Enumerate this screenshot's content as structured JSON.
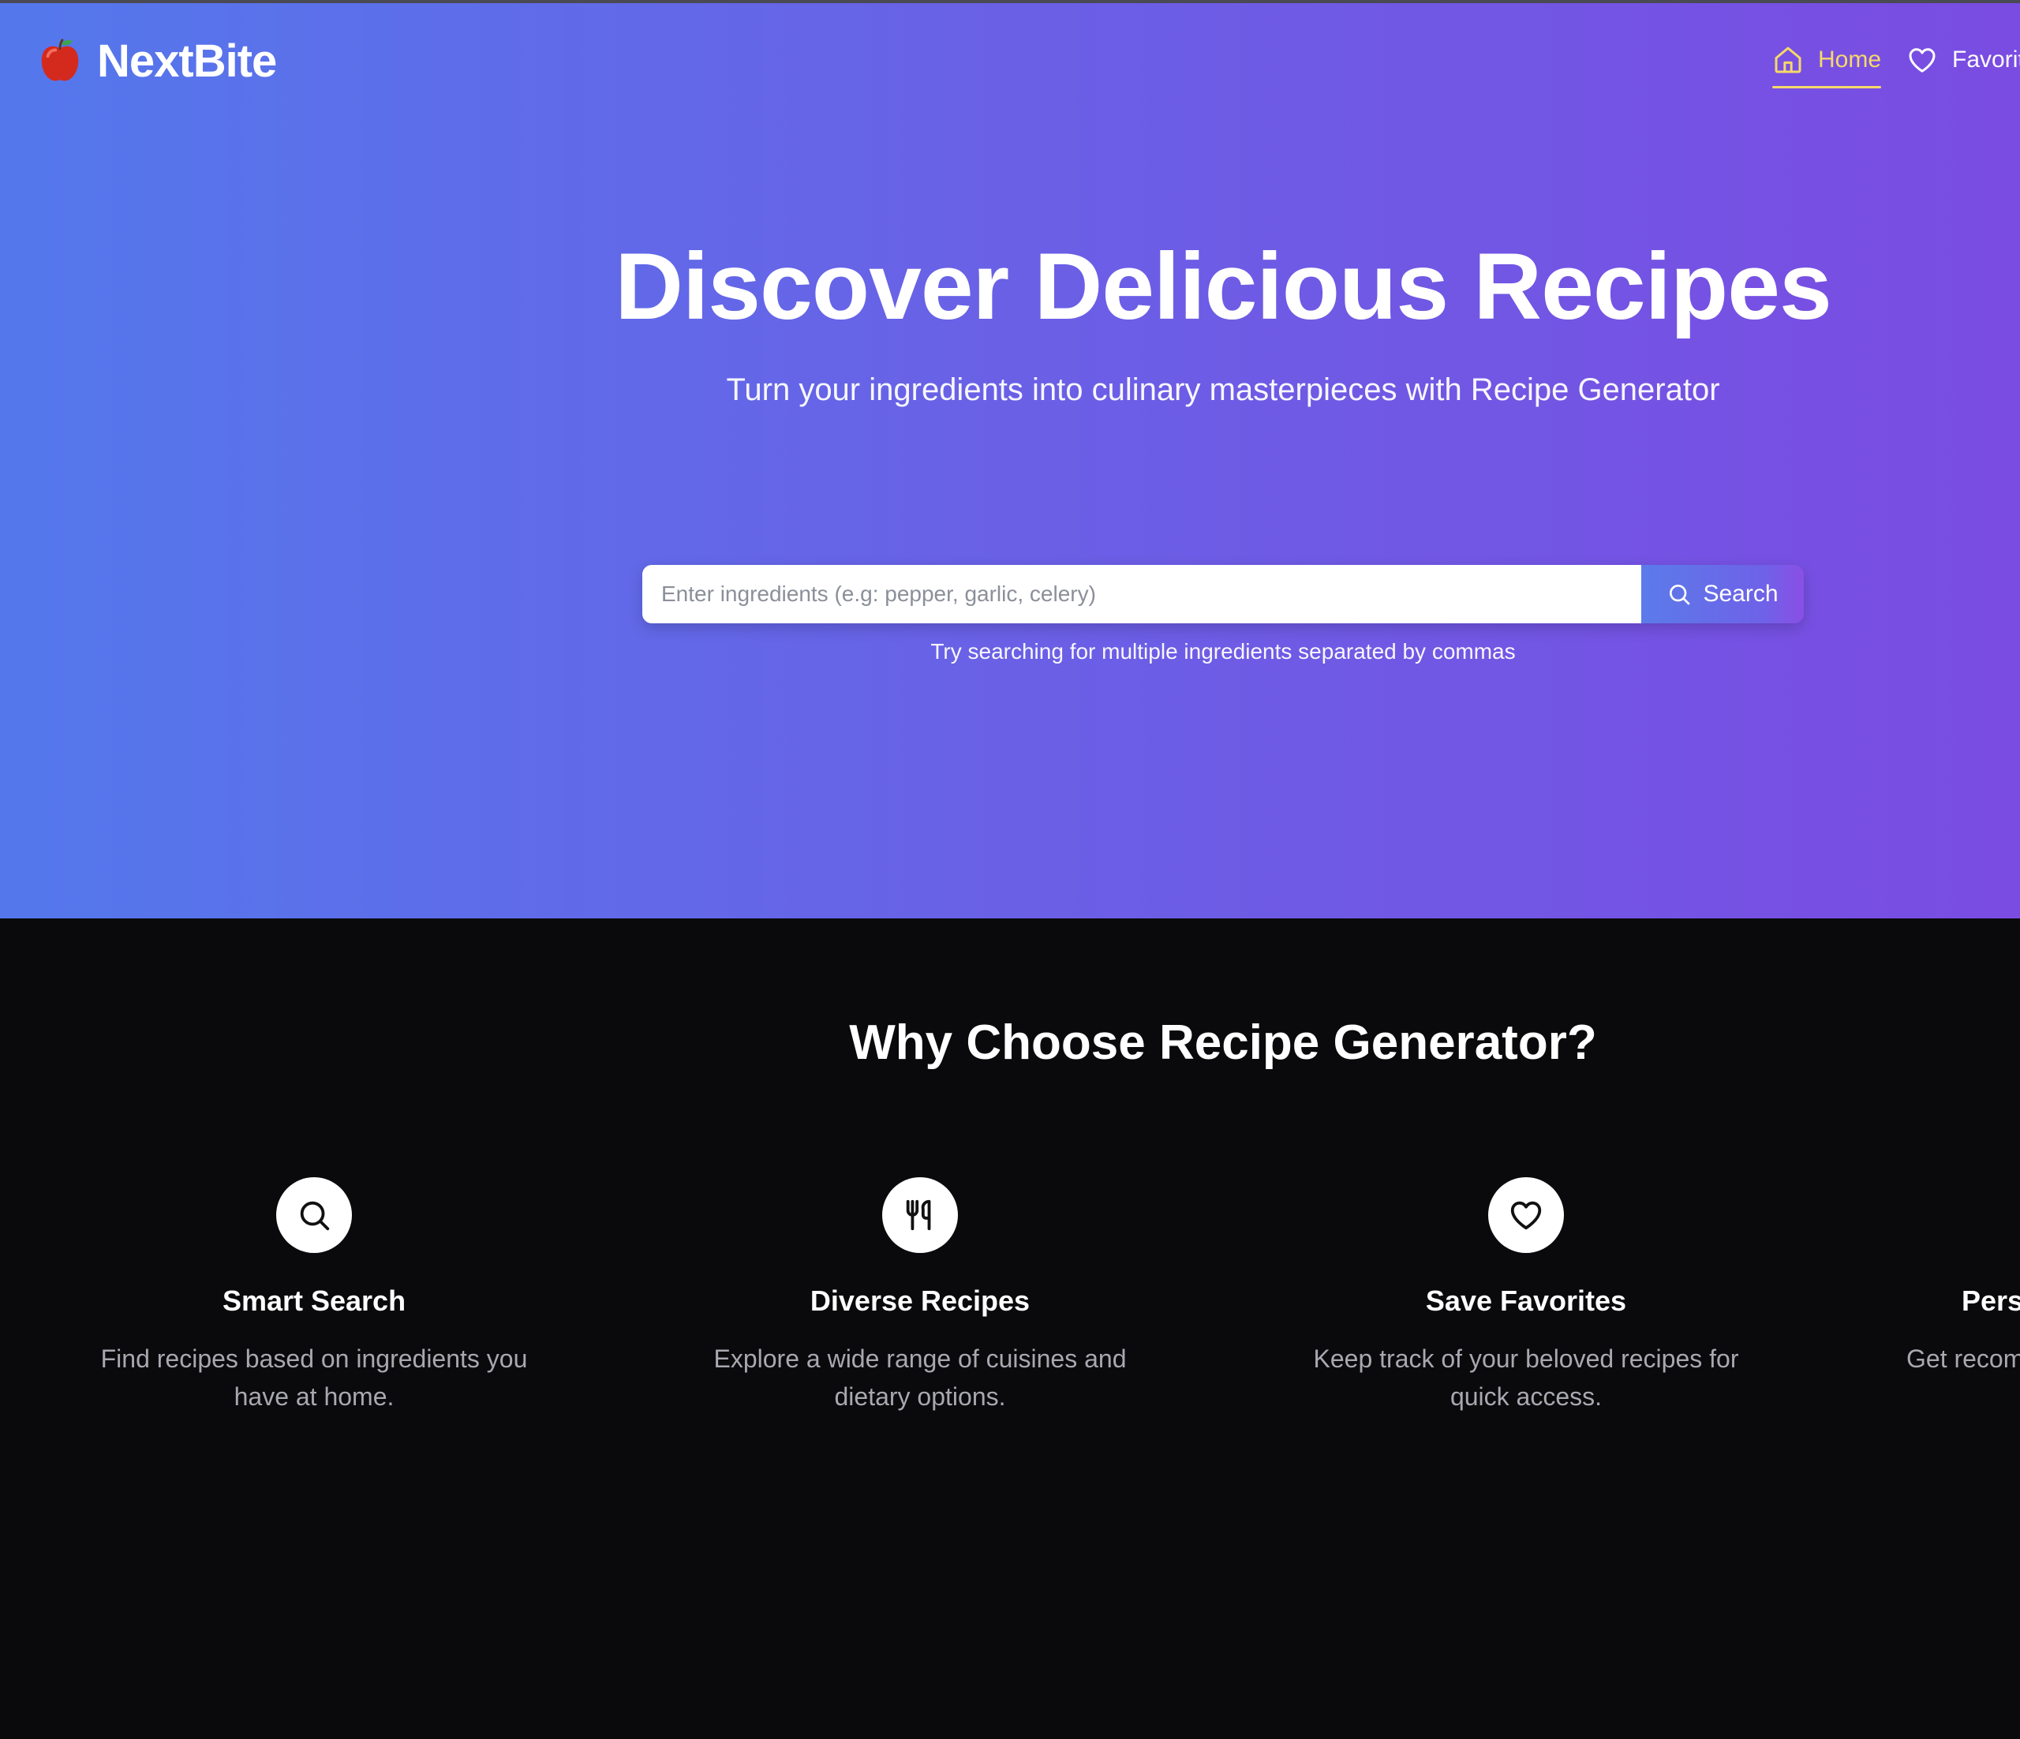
{
  "brand": {
    "name": "NextBite",
    "icon": "apple-icon"
  },
  "nav": {
    "home_label": "Home",
    "favorites_label": "Favorit",
    "active_color": "#f6d86a"
  },
  "hero": {
    "title": "Discover Delicious Recipes",
    "subtitle": "Turn your ingredients into culinary masterpieces with Recipe Generator",
    "gradient": [
      "#5478ec",
      "#7a4ce2"
    ]
  },
  "search": {
    "placeholder": "Enter ingredients (e.g: pepper, garlic, celery)",
    "value": "",
    "button_label": "Search",
    "hint": "Try searching for multiple ingredients separated by commas"
  },
  "features": {
    "title": "Why Choose Recipe Generator?",
    "items": [
      {
        "icon": "search-icon",
        "title": "Smart Search",
        "description": "Find recipes based on ingredients you have at home."
      },
      {
        "icon": "utensils-icon",
        "title": "Diverse Recipes",
        "description": "Explore a wide range of cuisines and dietary options."
      },
      {
        "icon": "heart-icon",
        "title": "Save Favorites",
        "description": "Keep track of your beloved recipes for quick access."
      },
      {
        "icon": "",
        "title": "Pers",
        "description": "Get recom"
      }
    ]
  }
}
